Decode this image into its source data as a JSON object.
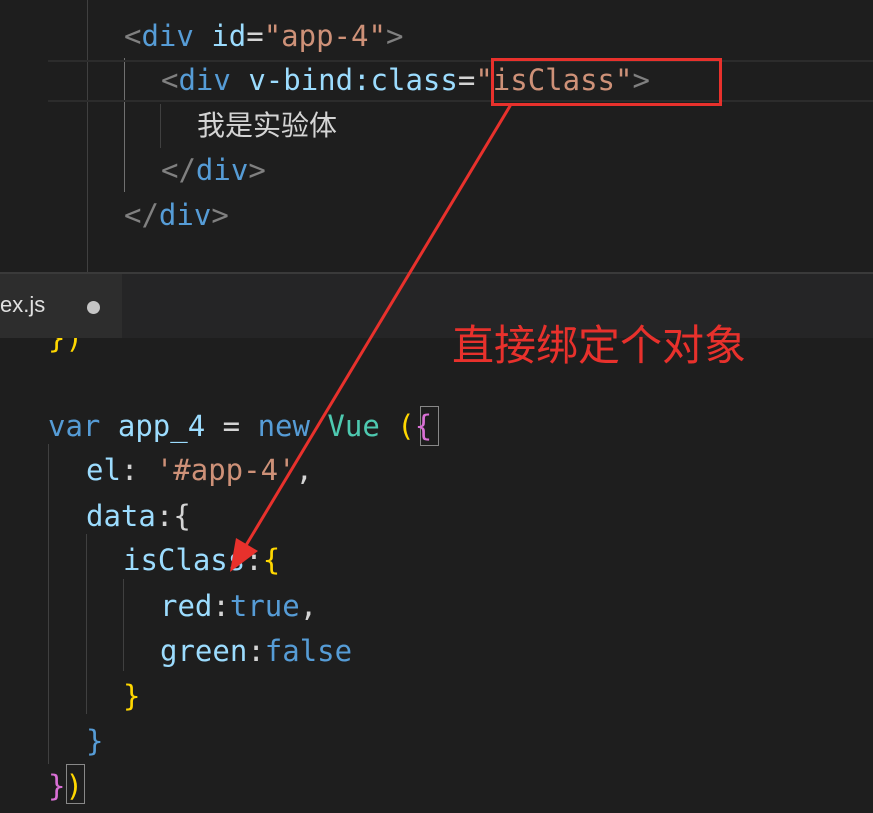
{
  "editor": {
    "tab": {
      "label": "ex.js"
    },
    "html_lines": [
      [
        {
          "t": "<",
          "c": "c-punc"
        },
        {
          "t": "div",
          "c": "c-tag"
        },
        {
          "t": " ",
          "c": "c-text"
        },
        {
          "t": "id",
          "c": "c-attr"
        },
        {
          "t": "=",
          "c": "c-text"
        },
        {
          "t": "\"app-4\"",
          "c": "c-str"
        },
        {
          "t": ">",
          "c": "c-punc"
        }
      ],
      [
        {
          "t": "<",
          "c": "c-punc"
        },
        {
          "t": "div",
          "c": "c-tag"
        },
        {
          "t": " ",
          "c": "c-text"
        },
        {
          "t": "v-bind:class",
          "c": "c-attr"
        },
        {
          "t": "=",
          "c": "c-text"
        },
        {
          "t": "\"isClass\"",
          "c": "c-str"
        },
        {
          "t": ">",
          "c": "c-punc"
        }
      ],
      [
        {
          "t": "我是实验体",
          "c": "c-text c-cjk"
        }
      ],
      [
        {
          "t": "</",
          "c": "c-punc"
        },
        {
          "t": "div",
          "c": "c-tag"
        },
        {
          "t": ">",
          "c": "c-punc"
        }
      ],
      [
        {
          "t": "</",
          "c": "c-punc"
        },
        {
          "t": "div",
          "c": "c-tag"
        },
        {
          "t": ">",
          "c": "c-punc"
        }
      ]
    ],
    "js_lines": [
      [
        {
          "t": "})",
          "c": "c-brk1"
        }
      ],
      [],
      [
        {
          "t": "var",
          "c": "c-kw"
        },
        {
          "t": " ",
          "c": "c-text"
        },
        {
          "t": "app_4",
          "c": "c-id"
        },
        {
          "t": " = ",
          "c": "c-op"
        },
        {
          "t": "new",
          "c": "c-kw"
        },
        {
          "t": " ",
          "c": "c-text"
        },
        {
          "t": "Vue",
          "c": "c-cls"
        },
        {
          "t": " ",
          "c": "c-text"
        },
        {
          "t": "(",
          "c": "c-brk1"
        },
        {
          "t": "{",
          "c": "c-brk2"
        }
      ],
      [
        {
          "t": "el",
          "c": "c-id"
        },
        {
          "t": ": ",
          "c": "c-op"
        },
        {
          "t": "'#app-4'",
          "c": "c-str"
        },
        {
          "t": ",",
          "c": "c-op"
        }
      ],
      [
        {
          "t": "data",
          "c": "c-id"
        },
        {
          "t": ":",
          "c": "c-op"
        },
        {
          "t": "{",
          "c": "c-text"
        }
      ],
      [
        {
          "t": "isClass",
          "c": "c-id"
        },
        {
          "t": ":",
          "c": "c-op"
        },
        {
          "t": "{",
          "c": "c-brk1"
        }
      ],
      [
        {
          "t": "red",
          "c": "c-id"
        },
        {
          "t": ":",
          "c": "c-op"
        },
        {
          "t": "true",
          "c": "c-kw"
        },
        {
          "t": ",",
          "c": "c-op"
        }
      ],
      [
        {
          "t": "green",
          "c": "c-id"
        },
        {
          "t": ":",
          "c": "c-op"
        },
        {
          "t": "false",
          "c": "c-kw"
        }
      ],
      [
        {
          "t": "}",
          "c": "c-brk1"
        }
      ],
      [
        {
          "t": "}",
          "c": "c-kw"
        }
      ],
      [
        {
          "t": "}",
          "c": "c-brk2"
        },
        {
          "t": ")",
          "c": "c-brk1"
        }
      ]
    ]
  },
  "annotation": {
    "text": "直接绑定个对象",
    "color": "#e8312c"
  },
  "colors": {
    "background": "#1e1e1e",
    "tag": "#569cd6",
    "attribute": "#9cdcfe",
    "string": "#ce9178",
    "class": "#4ec9b0",
    "bracket_gold": "#ffd700",
    "bracket_pink": "#da70d6"
  }
}
